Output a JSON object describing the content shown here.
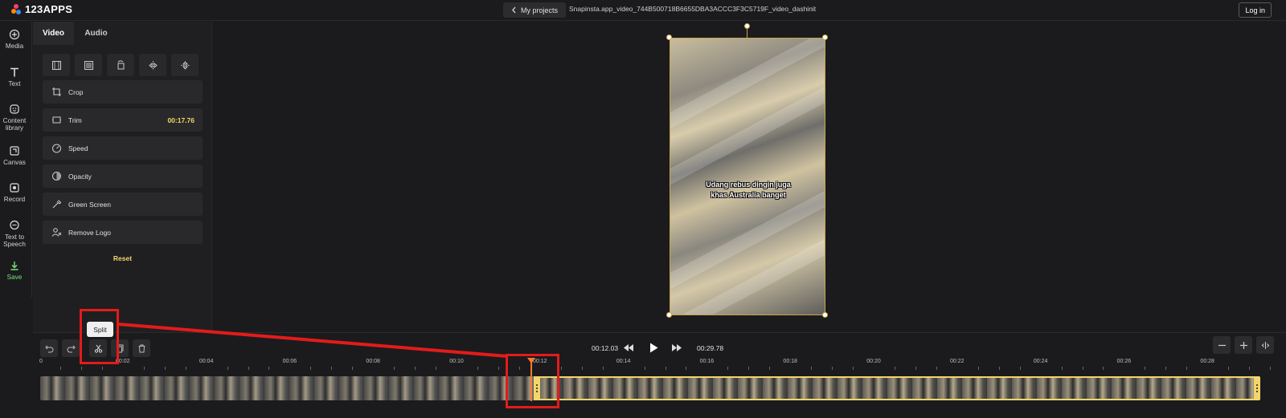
{
  "header": {
    "logo_text": "123APPS",
    "back_label": "My projects",
    "filename": "Snapinsta.app_video_744B500718B6655DBA3ACCC3F3C5719F_video_dashinit",
    "login_label": "Log in"
  },
  "rail": {
    "media": "Media",
    "text": "Text",
    "content_library_1": "Content",
    "content_library_2": "library",
    "canvas": "Canvas",
    "record": "Record",
    "tts_1": "Text to",
    "tts_2": "Speech",
    "save": "Save"
  },
  "panel": {
    "tab_video": "Video",
    "tab_audio": "Audio",
    "options": {
      "crop": "Crop",
      "trim": "Trim",
      "trim_value": "00:17.76",
      "speed": "Speed",
      "opacity": "Opacity",
      "green_screen": "Green Screen",
      "remove_logo": "Remove Logo"
    },
    "reset": "Reset"
  },
  "preview": {
    "caption_line1": "Udang rebus dingin juga",
    "caption_line2": "khas Australia banget"
  },
  "timeline": {
    "current_time": "00:12.03",
    "total_time": "00:29.78",
    "tooltip": "Split",
    "ticks": [
      "0",
      "00:02",
      "00:04",
      "00:06",
      "00:08",
      "00:10",
      "00:12",
      "00:14",
      "00:16",
      "00:18",
      "00:20",
      "00:22",
      "00:24",
      "00:26",
      "00:28"
    ]
  },
  "colors": {
    "accent": "#f2d66a",
    "playhead": "#ff7a2f",
    "annotation": "#e31b1b",
    "save": "#7fe07f"
  }
}
